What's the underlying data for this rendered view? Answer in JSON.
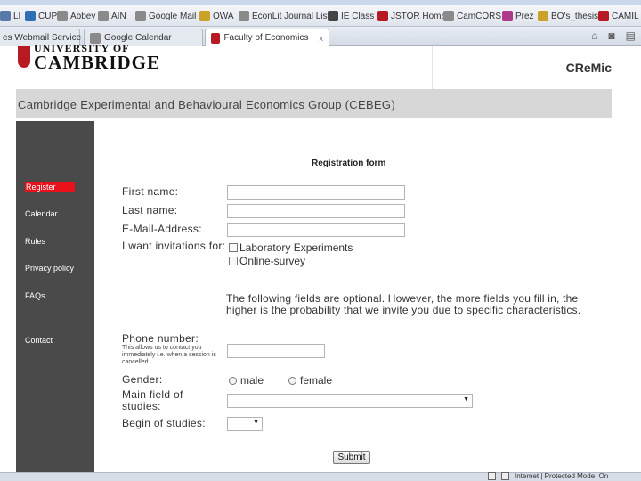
{
  "browser": {
    "links": [
      {
        "label": "LI",
        "icon": "page-icon",
        "color": "#5a78a8"
      },
      {
        "label": "CUP",
        "icon": "globe-icon",
        "color": "#2f6db5"
      },
      {
        "label": "Abbey",
        "icon": "page-icon",
        "color": "#8a8a8a"
      },
      {
        "label": "AIN",
        "icon": "page-icon",
        "color": "#8a8a8a"
      },
      {
        "label": "Google Mail",
        "icon": "page-icon",
        "color": "#8a8a8a"
      },
      {
        "label": "OWA",
        "icon": "page-icon",
        "color": "#c9a227"
      },
      {
        "label": "EconLit Journal List",
        "icon": "page-icon",
        "color": "#8a8a8a"
      },
      {
        "label": "IE Class",
        "icon": "page-icon",
        "color": "#444444"
      },
      {
        "label": "JSTOR Home",
        "icon": "jstor-icon",
        "color": "#b71a22"
      },
      {
        "label": "CamCORS",
        "icon": "page-icon",
        "color": "#8a8a8a"
      },
      {
        "label": "Prez",
        "icon": "page-icon",
        "color": "#b03a8a"
      },
      {
        "label": "BO's_thesis",
        "icon": "page-icon",
        "color": "#c9a227"
      },
      {
        "label": "CAMIL",
        "icon": "page-icon",
        "color": "#b71a22"
      }
    ],
    "tabs": [
      {
        "label": "es Webmail Service",
        "active": false
      },
      {
        "label": "Google Calendar",
        "active": false
      },
      {
        "label": "Faculty of Economics",
        "active": true
      }
    ],
    "tab_close": "x",
    "status_text": "Internet | Protected Mode: On"
  },
  "header": {
    "logo_top": "UNIVERSITY OF",
    "logo_bottom": "CAMBRIDGE",
    "site_tag": "CReMic",
    "group_title": "Cambridge Experimental and Behavioural Economics Group (CEBEG)"
  },
  "sidebar": {
    "items": [
      {
        "label": "Register",
        "active": true
      },
      {
        "label": "Calendar",
        "active": false
      },
      {
        "label": "Rules",
        "active": false
      },
      {
        "label": "Privacy policy",
        "active": false
      },
      {
        "label": "FAQs",
        "active": false
      },
      {
        "label": "Contact",
        "active": false
      }
    ]
  },
  "form": {
    "title": "Registration form",
    "first_name_label": "First name:",
    "first_name_value": "",
    "last_name_label": "Last name:",
    "last_name_value": "",
    "email_label": "E-Mail-Address:",
    "email_value": "",
    "invitations_label": "I want invitations for:",
    "invitation_options": [
      {
        "label": "Laboratory Experiments",
        "checked": false
      },
      {
        "label": "Online-survey",
        "checked": false
      }
    ],
    "optional_note": "The following fields are optional. However, the more fields you fill in, the higher is the probability that we invite you due to specific characteristics.",
    "phone_label": "Phone number:",
    "phone_hint": "This allows us to contact you immediately i.e. when a session is cancelled.",
    "phone_value": "",
    "gender_label": "Gender:",
    "gender_options": [
      {
        "label": "male",
        "selected": false
      },
      {
        "label": "female",
        "selected": false
      }
    ],
    "field_label": "Main field of studies:",
    "field_selected": "",
    "begin_label": "Begin of studies:",
    "begin_selected": "",
    "submit_label": "Submit"
  },
  "colors": {
    "sidebar_bg": "#4a4a4a",
    "active_nav": "#e8101a",
    "group_bar": "#d7d7d7"
  }
}
